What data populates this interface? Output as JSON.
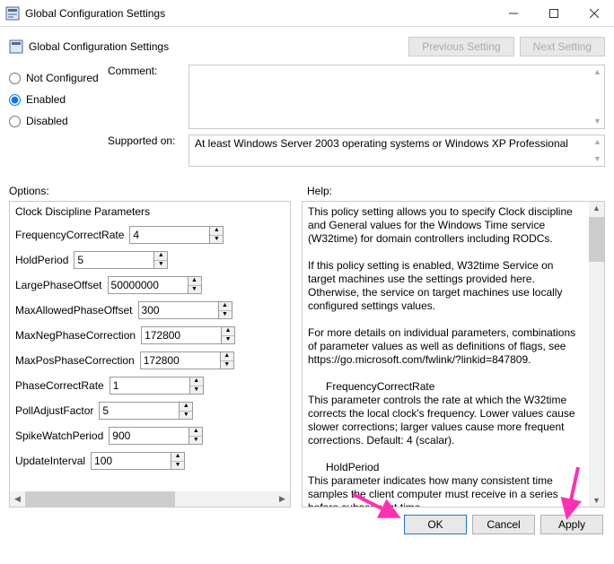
{
  "window": {
    "title": "Global Configuration Settings",
    "header": "Global Configuration Settings"
  },
  "nav": {
    "prev": "Previous Setting",
    "next": "Next Setting"
  },
  "state": {
    "not_configured": "Not Configured",
    "enabled": "Enabled",
    "disabled": "Disabled",
    "selected": "Enabled"
  },
  "meta": {
    "comment_label": "Comment:",
    "supported_label": "Supported on:",
    "comment": "",
    "supported": "At least Windows Server 2003 operating systems or Windows XP Professional"
  },
  "labels": {
    "options": "Options:",
    "help": "Help:"
  },
  "options": {
    "section": "Clock Discipline Parameters",
    "items": [
      {
        "label": "FrequencyCorrectRate",
        "value": "4"
      },
      {
        "label": "HoldPeriod",
        "value": "5"
      },
      {
        "label": "LargePhaseOffset",
        "value": "50000000"
      },
      {
        "label": "MaxAllowedPhaseOffset",
        "value": "300"
      },
      {
        "label": "MaxNegPhaseCorrection",
        "value": "172800"
      },
      {
        "label": "MaxPosPhaseCorrection",
        "value": "172800"
      },
      {
        "label": "PhaseCorrectRate",
        "value": "1"
      },
      {
        "label": "PollAdjustFactor",
        "value": "5"
      },
      {
        "label": "SpikeWatchPeriod",
        "value": "900"
      },
      {
        "label": "UpdateInterval",
        "value": "100"
      }
    ]
  },
  "help": {
    "text": "This policy setting allows you to specify Clock discipline and General values for the Windows Time service (W32time) for domain controllers including RODCs.\n\nIf this policy setting is enabled, W32time Service on target machines use the settings provided here. Otherwise, the service on target machines use locally configured settings values.\n\nFor more details on individual parameters, combinations of parameter values as well as definitions of flags, see https://go.microsoft.com/fwlink/?linkid=847809.\n\n      FrequencyCorrectRate\nThis parameter controls the rate at which the W32time corrects the local clock's frequency. Lower values cause slower corrections; larger values cause more frequent corrections. Default: 4 (scalar).\n\n      HoldPeriod\nThis parameter indicates how many consistent time samples the client computer must receive in a series before subsequent time"
  },
  "footer": {
    "ok": "OK",
    "cancel": "Cancel",
    "apply": "Apply"
  }
}
